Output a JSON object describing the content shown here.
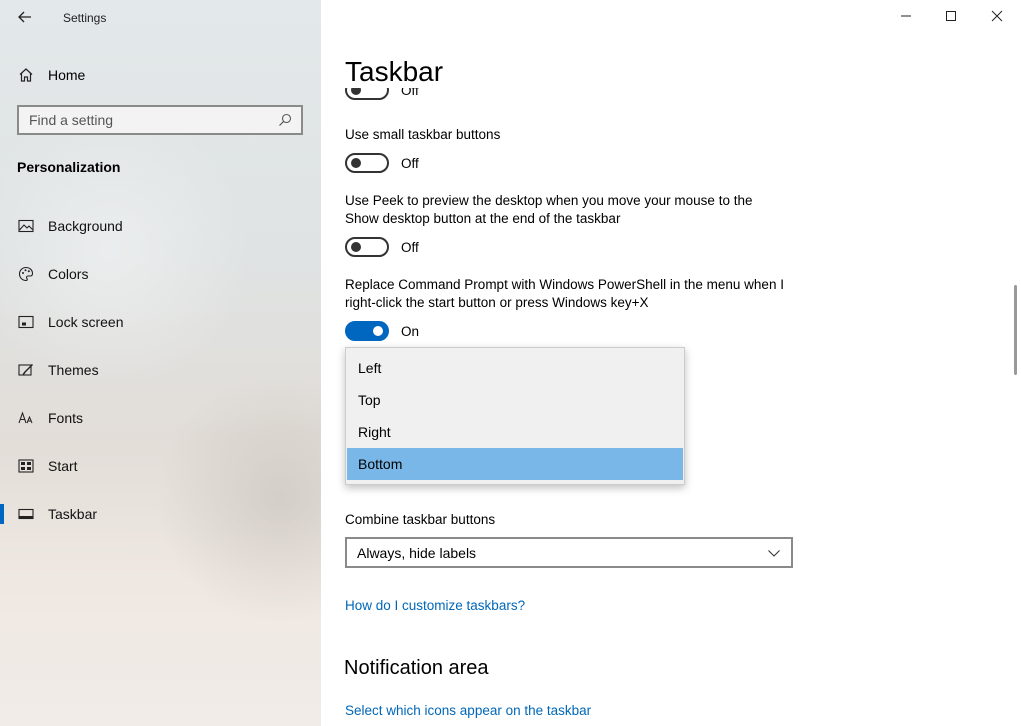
{
  "window": {
    "app_title": "Settings",
    "minimize_icon": "minimize-icon",
    "maximize_icon": "maximize-icon",
    "close_icon": "close-icon"
  },
  "sidebar": {
    "home_label": "Home",
    "search_placeholder": "Find a setting",
    "section_title": "Personalization",
    "items": [
      {
        "label": "Background",
        "icon": "background-icon"
      },
      {
        "label": "Colors",
        "icon": "palette-icon"
      },
      {
        "label": "Lock screen",
        "icon": "lock-screen-icon"
      },
      {
        "label": "Themes",
        "icon": "themes-icon"
      },
      {
        "label": "Fonts",
        "icon": "fonts-icon"
      },
      {
        "label": "Start",
        "icon": "start-icon"
      },
      {
        "label": "Taskbar",
        "icon": "taskbar-icon",
        "active": true
      }
    ],
    "accent_color": "#0067c0"
  },
  "main": {
    "page_title": "Taskbar",
    "partial_toggle_text": "Off",
    "settings": [
      {
        "label": "Use small taskbar buttons",
        "state": "Off",
        "on": false
      },
      {
        "label": "Use Peek to preview the desktop when you move your mouse to the Show desktop button at the end of the taskbar",
        "state": "Off",
        "on": false
      },
      {
        "label": "Replace Command Prompt with Windows PowerShell in the menu when I right-click the start button or press Windows key+X",
        "state": "On",
        "on": true
      }
    ],
    "location_dropdown": {
      "options": [
        "Left",
        "Top",
        "Right",
        "Bottom"
      ],
      "selected": "Bottom"
    },
    "combine_label": "Combine taskbar buttons",
    "combine_value": "Always, hide labels",
    "help_link": "How do I customize taskbars?",
    "notification_heading": "Notification area",
    "notification_link": "Select which icons appear on the taskbar"
  }
}
